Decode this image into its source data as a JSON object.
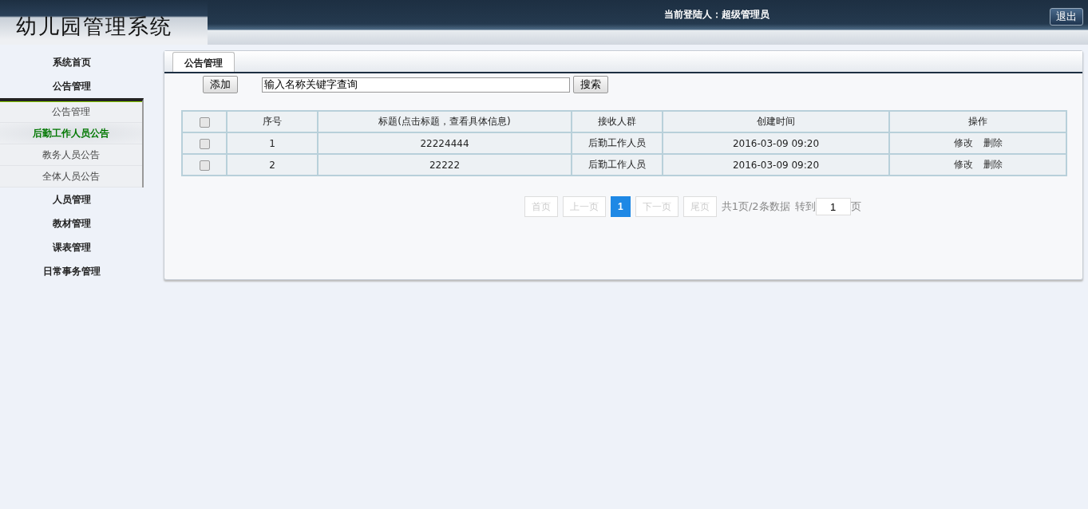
{
  "header": {
    "logo": "幼儿园管理系统",
    "login_label": "当前登陆人：",
    "login_user": "超级管理员",
    "logout": "退出"
  },
  "sidebar": {
    "items": [
      {
        "label": "系统首页"
      },
      {
        "label": "公告管理",
        "expanded": true,
        "children": [
          {
            "label": "公告管理",
            "selected": false
          },
          {
            "label": "后勤工作人员公告",
            "selected": true
          },
          {
            "label": "教务人员公告",
            "selected": false
          },
          {
            "label": "全体人员公告",
            "selected": false
          }
        ]
      },
      {
        "label": "人员管理"
      },
      {
        "label": "教材管理"
      },
      {
        "label": "课表管理"
      },
      {
        "label": "日常事务管理"
      }
    ]
  },
  "tabs": [
    {
      "label": "公告管理",
      "selected": true
    }
  ],
  "toolbar": {
    "add": "添加",
    "search_value": "输入名称关键字查询",
    "search": "搜索"
  },
  "table": {
    "all_checked": false,
    "columns": [
      "序号",
      "标题(点击标题，查看具体信息)",
      "接收人群",
      "创建时间",
      "操作"
    ],
    "rows": [
      {
        "checked": false,
        "no": "1",
        "title": "22224444",
        "audience": "后勤工作人员",
        "created": "2016-03-09 09:20",
        "actions": [
          "修改",
          "删除"
        ]
      },
      {
        "checked": false,
        "no": "2",
        "title": "22222",
        "audience": "后勤工作人员",
        "created": "2016-03-09 09:20",
        "actions": [
          "修改",
          "删除"
        ]
      }
    ]
  },
  "pagination": {
    "buttons": [
      {
        "label": "首页",
        "disabled": true,
        "selected": false
      },
      {
        "label": "上一页",
        "disabled": true,
        "selected": false
      },
      {
        "label": "1",
        "disabled": false,
        "selected": true
      },
      {
        "label": "下一页",
        "disabled": true,
        "selected": false
      },
      {
        "label": "尾页",
        "disabled": true,
        "selected": false
      }
    ],
    "summary": "共1页/2条数据",
    "goto_label": "转到",
    "goto_value": "1",
    "page_unit": "页"
  }
}
